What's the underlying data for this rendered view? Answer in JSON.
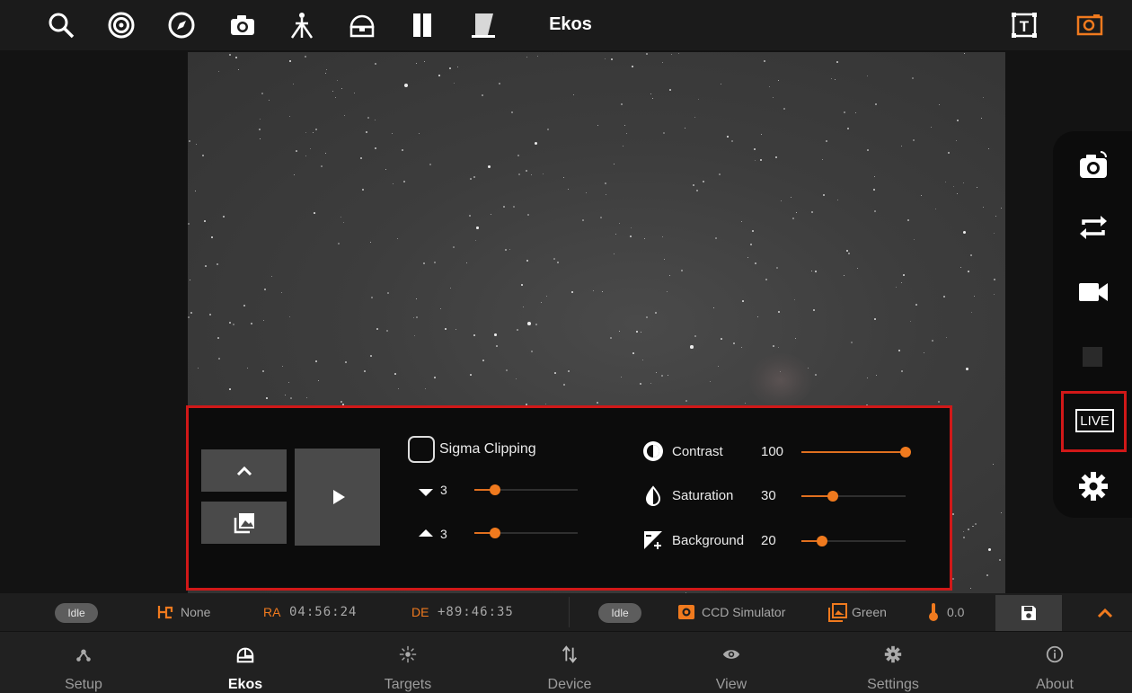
{
  "topbar": {
    "title": "Ekos",
    "icons": [
      "search-icon",
      "target-icon",
      "compass-icon",
      "camera-icon",
      "tripod-icon",
      "dome-icon",
      "filter-icon",
      "flat-panel-icon",
      "text-mode-icon",
      "frame-icon"
    ]
  },
  "right_tools": {
    "items": [
      "capture-icon",
      "loop-icon",
      "video-icon",
      "stop-icon",
      "live-icon",
      "settings-icon"
    ],
    "live_label": "LIVE"
  },
  "controls": {
    "sigma_clipping_label": "Sigma Clipping",
    "sigma_clipping_checked": false,
    "sigma_low_value": "3",
    "sigma_high_value": "3",
    "sigma_low_level": 0.2,
    "sigma_high_level": 0.2,
    "contrast_label": "Contrast",
    "contrast_value": "100",
    "contrast_level": 1.0,
    "saturation_label": "Saturation",
    "saturation_value": "30",
    "saturation_level": 0.3,
    "background_label": "Background",
    "background_value": "20",
    "background_level": 0.2
  },
  "status": {
    "mount_state": "Idle",
    "mount_park": "None",
    "ra_label": "RA",
    "ra_value": "04:56:24",
    "de_label": "DE",
    "de_value": "+89:46:35",
    "camera_state": "Idle",
    "camera_name": "CCD Simulator",
    "filter_name": "Green",
    "temperature": "0.0"
  },
  "bottom_nav": {
    "items": [
      {
        "label": "Setup",
        "icon": "setup-icon"
      },
      {
        "label": "Ekos",
        "icon": "ekos-icon"
      },
      {
        "label": "Targets",
        "icon": "targets-icon"
      },
      {
        "label": "Device",
        "icon": "device-icon"
      },
      {
        "label": "View",
        "icon": "view-icon"
      },
      {
        "label": "Settings",
        "icon": "settings-icon"
      },
      {
        "label": "About",
        "icon": "about-icon"
      }
    ],
    "active": "Ekos"
  },
  "colors": {
    "accent": "#f07a1e",
    "highlight_border": "#d11818"
  }
}
